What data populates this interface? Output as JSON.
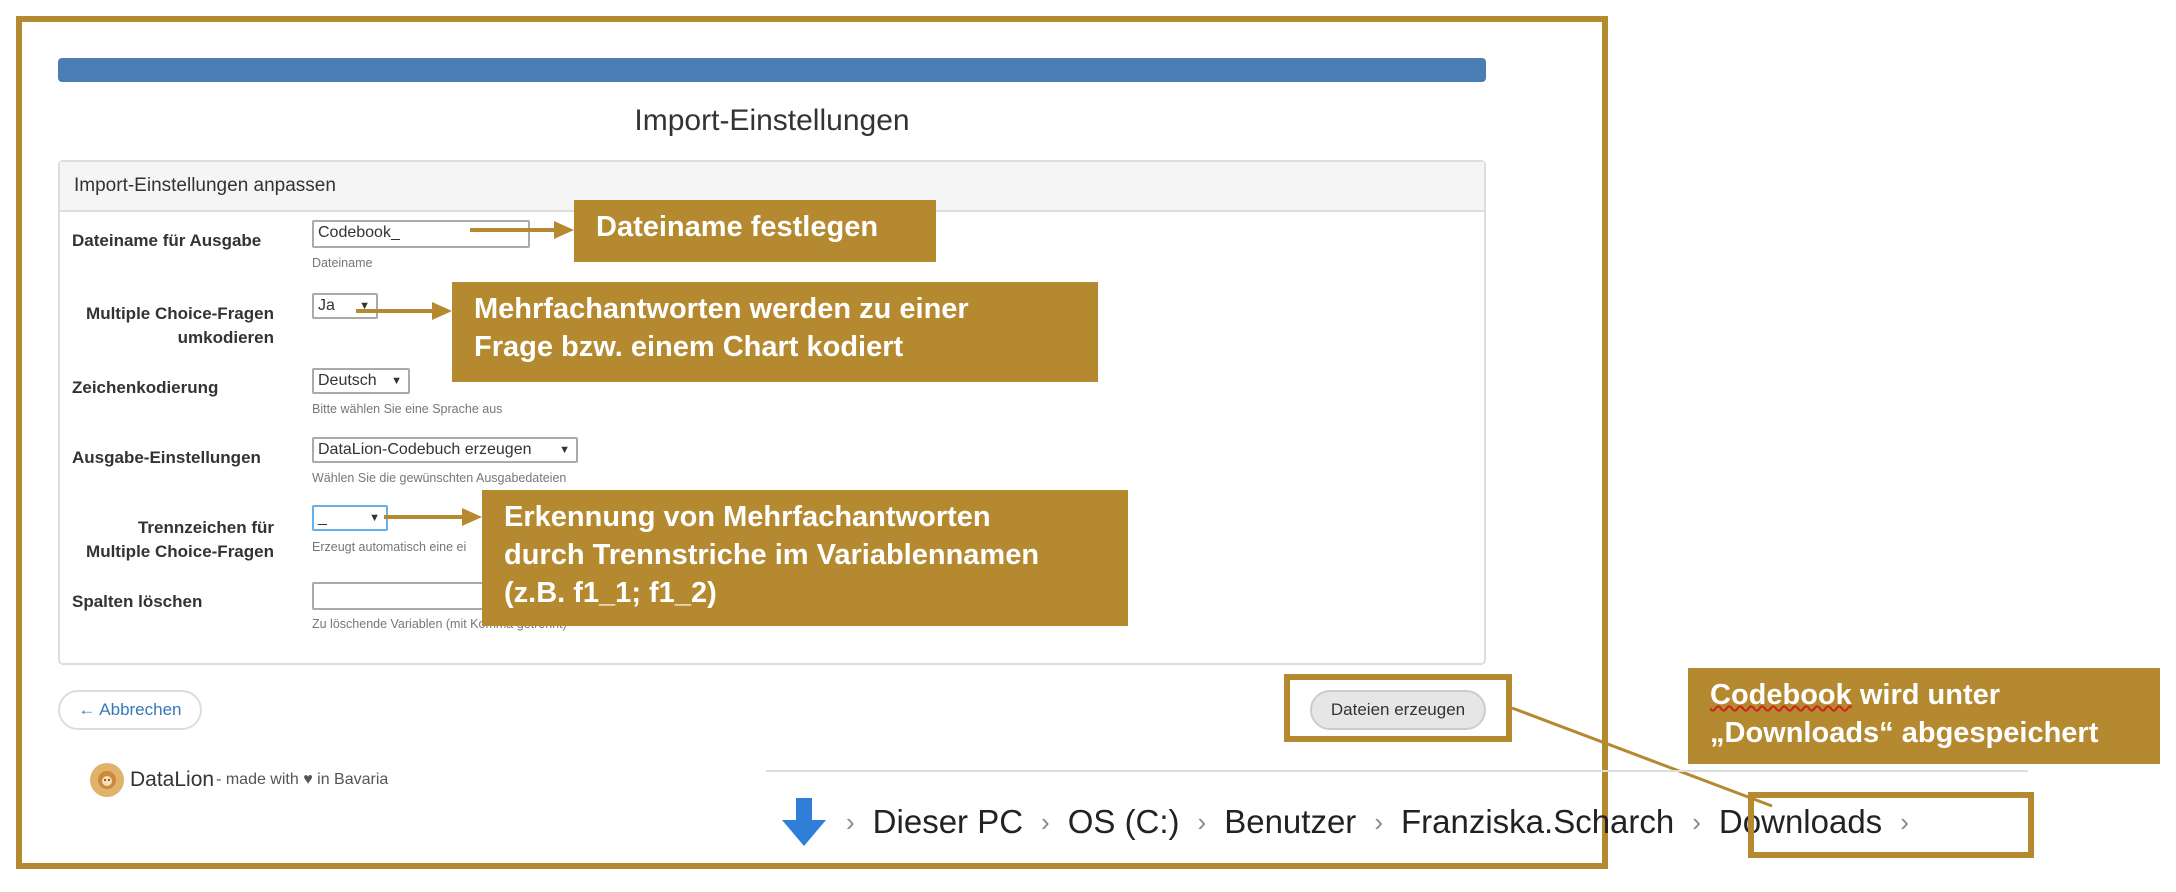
{
  "page": {
    "title": "Import-Einstellungen",
    "panel_title": "Import-Einstellungen anpassen"
  },
  "form": {
    "filename": {
      "label": "Dateiname für Ausgabe",
      "value": "Codebook_",
      "help": "Dateiname"
    },
    "multiple_choice": {
      "label_line1": "Multiple Choice-Fragen",
      "label_line2": "umkodieren",
      "value": "Ja"
    },
    "encoding": {
      "label": "Zeichenkodierung",
      "value": "Deutsch",
      "help": "Bitte wählen Sie eine Sprache aus"
    },
    "output": {
      "label": "Ausgabe-Einstellungen",
      "value": "DataLion-Codebuch erzeugen",
      "help": "Wählen Sie die gewünschten Ausgabedateien"
    },
    "separator": {
      "label_line1": "Trennzeichen für",
      "label_line2": "Multiple Choice-Fragen",
      "value": "_",
      "help": "Erzeugt automatisch eine ei"
    },
    "delete_columns": {
      "label": "Spalten löschen",
      "value": "",
      "help": "Zu löschende Variablen (mit Komma getrennt)"
    }
  },
  "buttons": {
    "cancel": "← Abbrechen",
    "create": "Dateien erzeugen"
  },
  "footer": {
    "brand": "DataLion",
    "tagline": "- made with ♥ in Bavaria"
  },
  "callouts": {
    "filename": "Dateiname festlegen",
    "multiple_line1": "Mehrfachantworten werden zu einer",
    "multiple_line2": "Frage bzw. einem Chart kodiert",
    "separator_line1": "Erkennung von Mehrfachantworten",
    "separator_line2": "durch Trennstriche im Variablennamen",
    "separator_line3": "(z.B. f1_1; f1_2)",
    "downloads_word": "Codebook",
    "downloads_rest_line1": " wird unter",
    "downloads_line2": "„Downloads“ abgespeichert"
  },
  "explorer": {
    "crumbs": [
      "Dieser PC",
      "OS (C:)",
      "Benutzer",
      "Franziska.Scharch",
      "Downloads"
    ]
  },
  "colors": {
    "accent": "#b5892f",
    "header_bar": "#4a7db3",
    "link": "#337ab7"
  },
  "icons": {
    "explorer_arrow": "down-arrow-icon",
    "logo": "lion-logo-icon"
  }
}
